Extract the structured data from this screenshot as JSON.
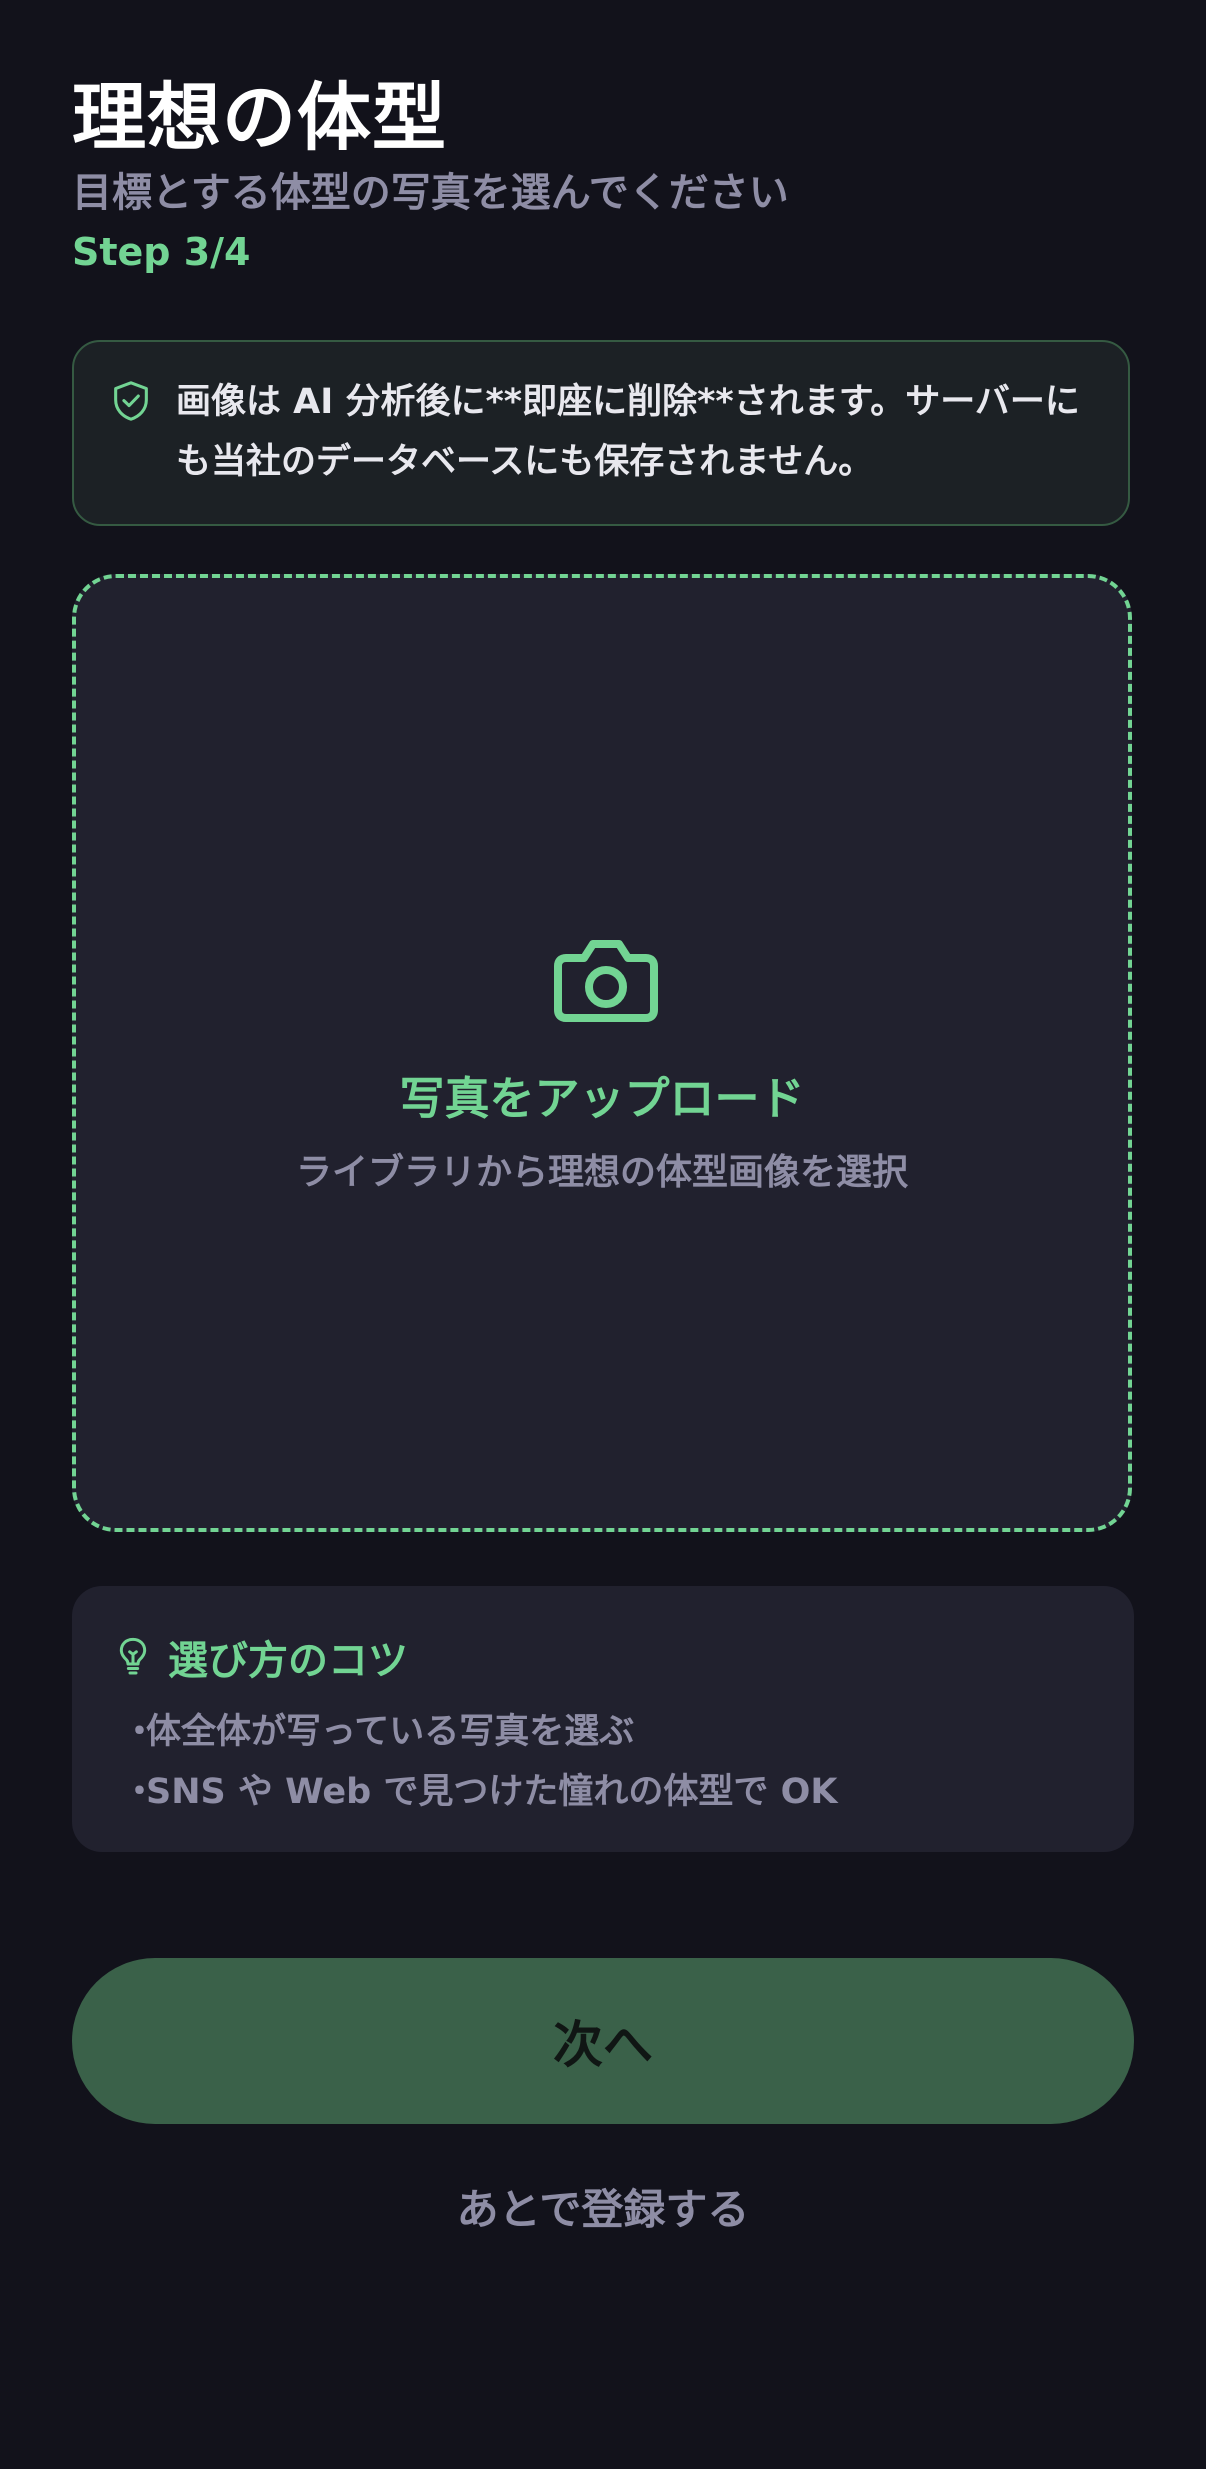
{
  "header": {
    "title": "理想の体型",
    "subtitle": "目標とする体型の写真を選んでください",
    "step": "Step 3/4"
  },
  "privacy_notice": {
    "icon": "shield-check-icon",
    "text": "画像は AI 分析後に**即座に削除**されます。サーバーにも当社のデータベースにも保存されません。"
  },
  "upload": {
    "icon": "camera-icon",
    "label": "写真をアップロード",
    "sublabel": "ライブラリから理想の体型画像を選択"
  },
  "tips": {
    "icon": "lightbulb-icon",
    "title": "選び方のコツ",
    "items": [
      "体全体が写っている写真を選ぶ",
      "SNS や Web で見つけた憧れの体型で OK"
    ]
  },
  "actions": {
    "next_label": "次へ",
    "later_label": "あとで登録する"
  },
  "colors": {
    "background": "#12121b",
    "accent": "#72d493",
    "card": "#21212e",
    "button": "#3a6149",
    "muted_text": "#8e8da5"
  }
}
